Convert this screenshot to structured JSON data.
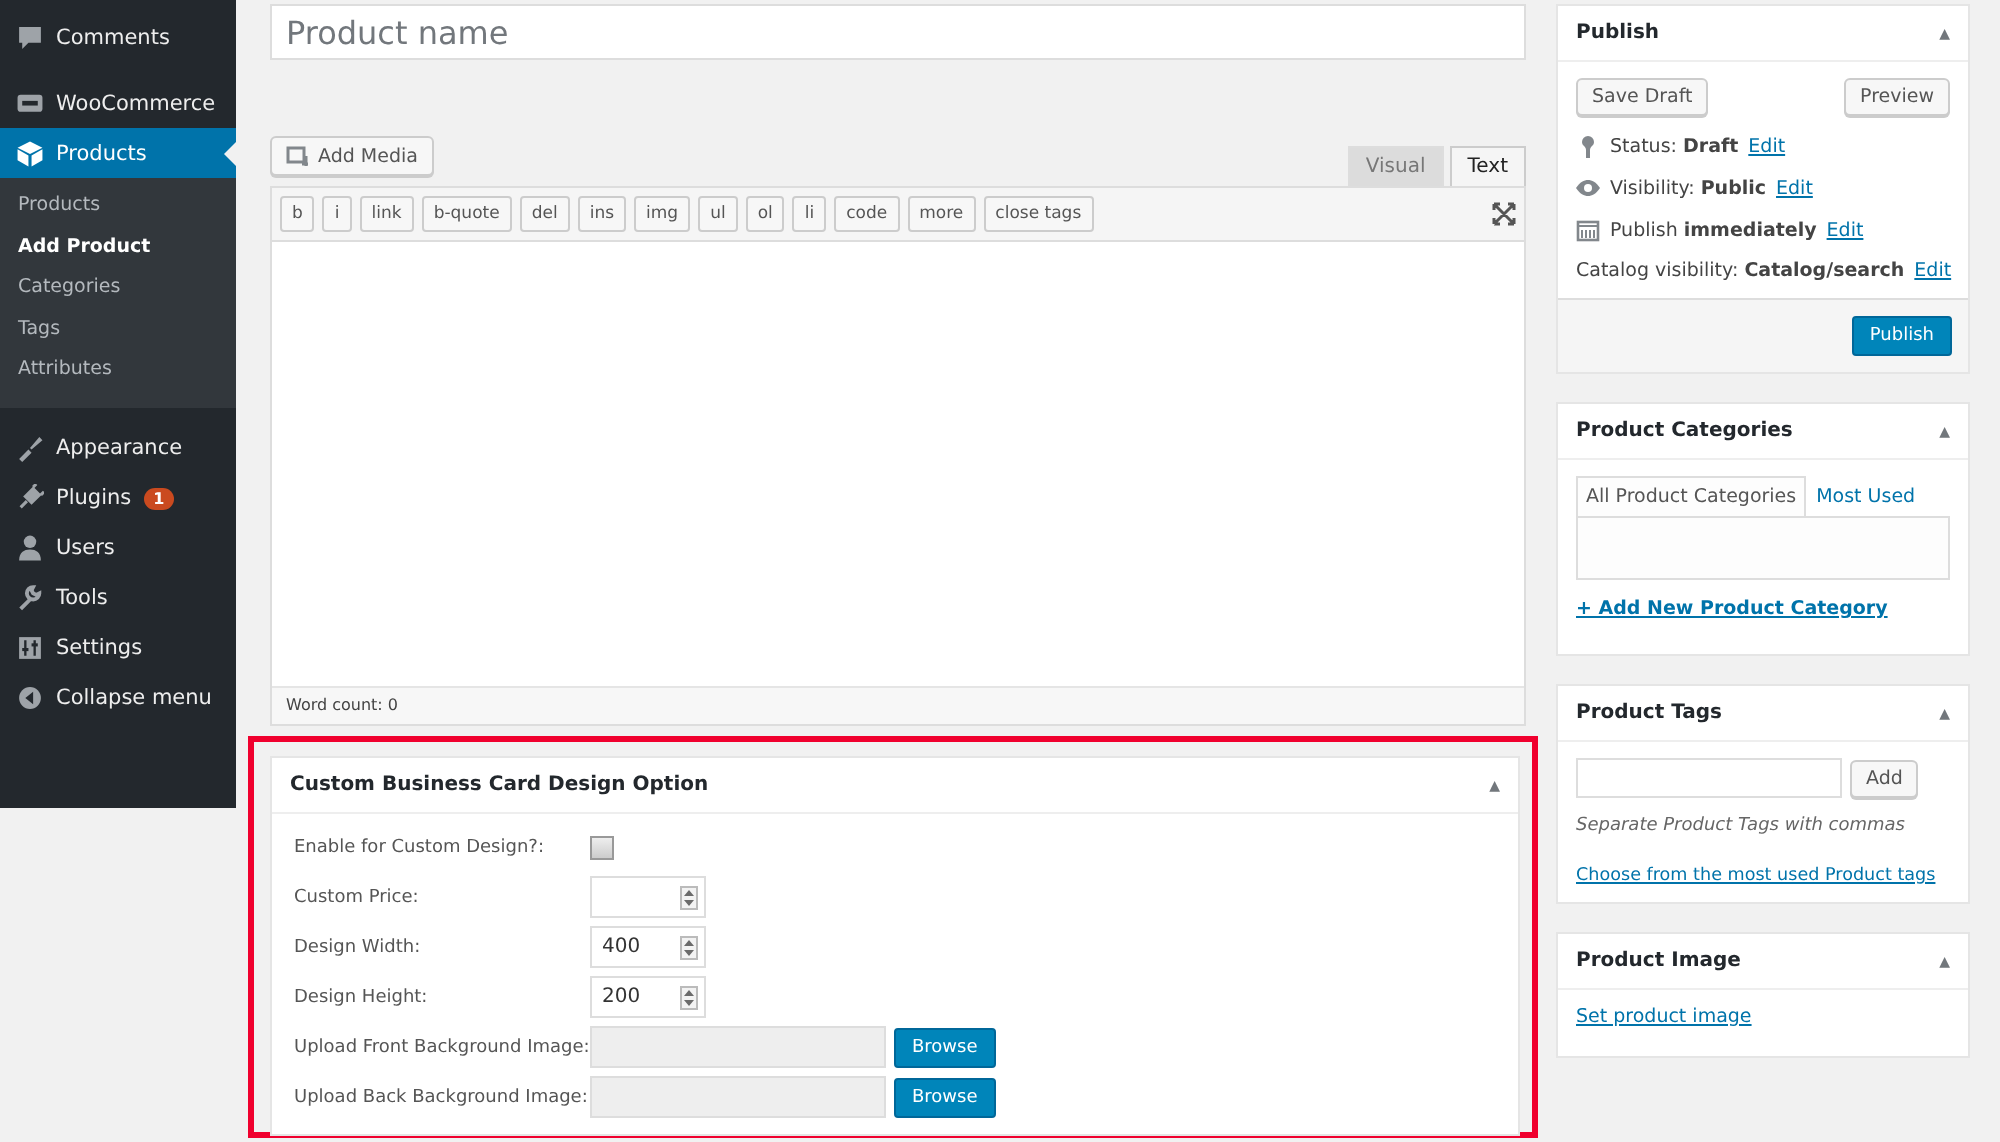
{
  "sidebar": {
    "items": [
      {
        "label": "Comments",
        "selected": false
      },
      {
        "label": "WooCommerce",
        "selected": false
      },
      {
        "label": "Products",
        "selected": true,
        "children": [
          {
            "label": "Products",
            "selected": false
          },
          {
            "label": "Add Product",
            "selected": true
          },
          {
            "label": "Categories",
            "selected": false
          },
          {
            "label": "Tags",
            "selected": false
          },
          {
            "label": "Attributes",
            "selected": false
          }
        ]
      },
      {
        "label": "Appearance",
        "selected": false
      },
      {
        "label": "Plugins",
        "selected": false,
        "badge": "1"
      },
      {
        "label": "Users",
        "selected": false
      },
      {
        "label": "Tools",
        "selected": false
      },
      {
        "label": "Settings",
        "selected": false
      },
      {
        "label": "Collapse menu",
        "selected": false
      }
    ]
  },
  "title_field": {
    "placeholder": "Product name"
  },
  "editor": {
    "add_media": "Add Media",
    "tabs": [
      {
        "label": "Visual",
        "selected": false
      },
      {
        "label": "Text",
        "selected": true
      }
    ],
    "toolbar": [
      "b",
      "i",
      "link",
      "b-quote",
      "del",
      "ins",
      "img",
      "ul",
      "ol",
      "li",
      "code",
      "more",
      "close tags"
    ],
    "word_count": "Word count: 0"
  },
  "custom_box": {
    "title": "Custom Business Card Design Option",
    "collapse": "▲",
    "rows": [
      {
        "kind": "checkbox",
        "label": "Enable for Custom Design?:",
        "checked": false
      },
      {
        "kind": "number",
        "label": "Custom Price:"
      },
      {
        "kind": "number",
        "label": "Design Width:",
        "value": "400"
      },
      {
        "kind": "number",
        "label": "Design Height:",
        "value": "200"
      },
      {
        "kind": "file",
        "label": "Upload Front Background Image:",
        "button": "Browse"
      },
      {
        "kind": "file",
        "label": "Upload Back Background Image:",
        "button": "Browse"
      }
    ]
  },
  "publish": {
    "title": "Publish",
    "collapse": "▲",
    "save_draft": "Save Draft",
    "preview": "Preview",
    "lines": [
      {
        "text": "Status: **Draft**",
        "link": "Edit"
      },
      {
        "text": "Visibility: **Public**",
        "link": "Edit"
      },
      {
        "text": "Publish **immediately**",
        "link": "Edit"
      },
      {
        "text": "Catalog visibility: **Catalog/search**",
        "link": "Edit"
      }
    ],
    "button": "Publish"
  },
  "categories": {
    "title": "Product Categories",
    "collapse": "▲",
    "tabs": [
      {
        "label": "All Product Categories",
        "selected": true
      },
      {
        "label": "Most Used",
        "selected": false
      }
    ],
    "add_link": "+ Add New Product Category"
  },
  "tags": {
    "title": "Product Tags",
    "collapse": "▲",
    "button": "Add",
    "hint": "Separate Product Tags with commas",
    "link": "Choose from the most used Product tags"
  },
  "image": {
    "title": "Product Image",
    "collapse": "▲",
    "link": "Set product image"
  }
}
